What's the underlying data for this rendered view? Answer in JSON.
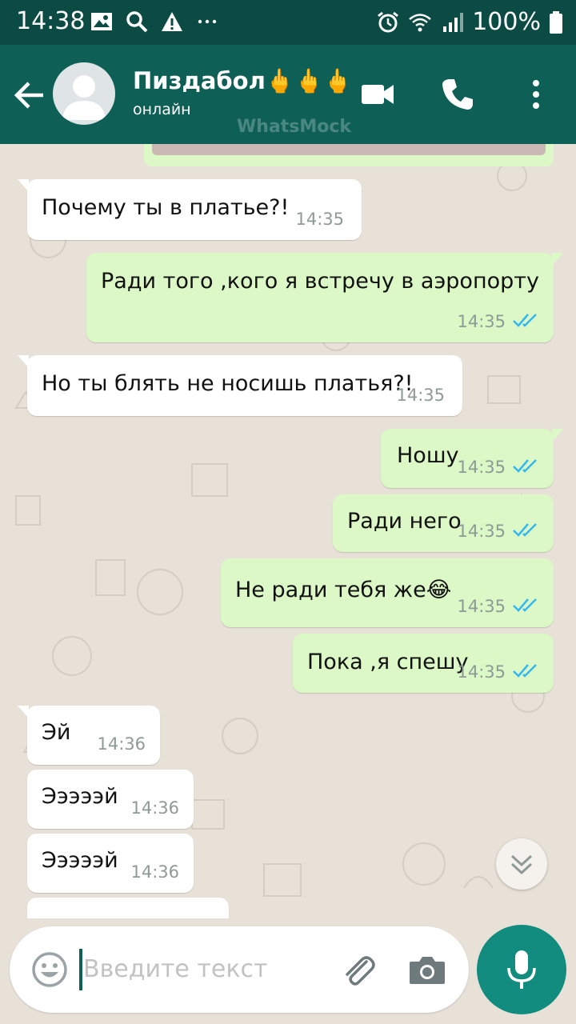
{
  "status_bar": {
    "time": "14:38",
    "battery": "100%"
  },
  "header": {
    "contact_name": "Пиздабол🖕🖕🖕",
    "status": "онлайн",
    "watermark": "WhatsMock"
  },
  "messages": [
    {
      "direction": "in",
      "text": "Почему ты в платье?!",
      "time": "14:35"
    },
    {
      "direction": "out",
      "text": "Ради того ,кого я встречу в аэропорту",
      "time": "14:35",
      "read": true
    },
    {
      "direction": "in",
      "text": "Но ты блять не носишь платья?!",
      "time": "14:35"
    },
    {
      "direction": "out",
      "text": "Ношу",
      "time": "14:35",
      "read": true
    },
    {
      "direction": "out",
      "text": "Ради него",
      "time": "14:35",
      "read": true
    },
    {
      "direction": "out",
      "text": "Не ради тебя же😂",
      "time": "14:35",
      "read": true
    },
    {
      "direction": "out",
      "text": "Пока ,я спешу",
      "time": "14:35",
      "read": true
    },
    {
      "direction": "in",
      "text": "Эй",
      "time": "14:36"
    },
    {
      "direction": "in",
      "text": "Эээээй",
      "time": "14:36"
    },
    {
      "direction": "in",
      "text": "Эээээй",
      "time": "14:36"
    }
  ],
  "composer": {
    "placeholder": "Введите текст"
  },
  "colors": {
    "header": "#0e5f56",
    "status_bar": "#0b4b44",
    "outgoing_bubble": "#dcf8c6",
    "incoming_bubble": "#ffffff",
    "read_ticks": "#34b7f1",
    "fab": "#128c7e"
  }
}
